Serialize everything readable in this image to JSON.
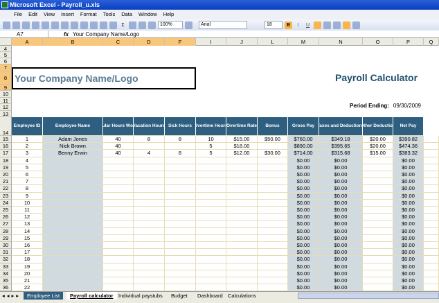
{
  "window": {
    "title": "Microsoft Excel - Payroll_u.xls"
  },
  "menu": [
    "File",
    "Edit",
    "View",
    "Insert",
    "Format",
    "Tools",
    "Data",
    "Window",
    "Help"
  ],
  "toolbar": {
    "zoom": "100%",
    "font": "Arial",
    "font_size": "18",
    "bold": "B",
    "italic": "I",
    "underline": "U",
    "sigma": "Σ"
  },
  "formula_bar": {
    "name_box": "A7",
    "fx": "fx",
    "value": "Your Company Name/Logo"
  },
  "columns": [
    "A",
    "B",
    "C",
    "D",
    "F",
    "I",
    "J",
    "L",
    "M",
    "N",
    "O",
    "P",
    "Q"
  ],
  "sheet": {
    "company": "Your Company Name/Logo",
    "title": "Payroll Calculator",
    "period_label": "Period Ending:",
    "period_value": "09/30/2009",
    "headers": [
      "Employee ID",
      "Employee Name",
      "Regular Hours Worked",
      "Vacation Hours",
      "Sick Hours",
      "Overtime Hours",
      "Overtime Rate",
      "Bonus",
      "Gross Pay",
      "Taxes and Deductions",
      "Other Deduction",
      "Net Pay"
    ],
    "rows": [
      [
        "1",
        "Adam Jones",
        "40",
        "8",
        "8",
        "10",
        "$15.00",
        "$50.00",
        "$760.00",
        "$349.18",
        "$20.00",
        "$390.82"
      ],
      [
        "2",
        "Nick Brown",
        "40",
        "",
        "",
        "5",
        "$18.00",
        "",
        "$890.00",
        "$395.65",
        "$20.00",
        "$474.36"
      ],
      [
        "3",
        "Benny Erwin",
        "40",
        "4",
        "8",
        "5",
        "$12.00",
        "$30.00",
        "$714.00",
        "$315.68",
        "$15.00",
        "$383.32"
      ],
      [
        "4",
        "",
        "",
        "",
        "",
        "",
        "",
        "",
        "$0.00",
        "$0.00",
        "",
        "$0.00"
      ],
      [
        "5",
        "",
        "",
        "",
        "",
        "",
        "",
        "",
        "$0.00",
        "$0.00",
        "",
        "$0.00"
      ],
      [
        "6",
        "",
        "",
        "",
        "",
        "",
        "",
        "",
        "$0.00",
        "$0.00",
        "",
        "$0.00"
      ],
      [
        "7",
        "",
        "",
        "",
        "",
        "",
        "",
        "",
        "$0.00",
        "$0.00",
        "",
        "$0.00"
      ],
      [
        "8",
        "",
        "",
        "",
        "",
        "",
        "",
        "",
        "$0.00",
        "$0.00",
        "",
        "$0.00"
      ],
      [
        "9",
        "",
        "",
        "",
        "",
        "",
        "",
        "",
        "$0.00",
        "$0.00",
        "",
        "$0.00"
      ],
      [
        "10",
        "",
        "",
        "",
        "",
        "",
        "",
        "",
        "$0.00",
        "$0.00",
        "",
        "$0.00"
      ],
      [
        "11",
        "",
        "",
        "",
        "",
        "",
        "",
        "",
        "$0.00",
        "$0.00",
        "",
        "$0.00"
      ],
      [
        "12",
        "",
        "",
        "",
        "",
        "",
        "",
        "",
        "$0.00",
        "$0.00",
        "",
        "$0.00"
      ],
      [
        "13",
        "",
        "",
        "",
        "",
        "",
        "",
        "",
        "$0.00",
        "$0.00",
        "",
        "$0.00"
      ],
      [
        "14",
        "",
        "",
        "",
        "",
        "",
        "",
        "",
        "$0.00",
        "$0.00",
        "",
        "$0.00"
      ],
      [
        "15",
        "",
        "",
        "",
        "",
        "",
        "",
        "",
        "$0.00",
        "$0.00",
        "",
        "$0.00"
      ],
      [
        "16",
        "",
        "",
        "",
        "",
        "",
        "",
        "",
        "$0.00",
        "$0.00",
        "",
        "$0.00"
      ],
      [
        "17",
        "",
        "",
        "",
        "",
        "",
        "",
        "",
        "$0.00",
        "$0.00",
        "",
        "$0.00"
      ],
      [
        "18",
        "",
        "",
        "",
        "",
        "",
        "",
        "",
        "$0.00",
        "$0.00",
        "",
        "$0.00"
      ],
      [
        "19",
        "",
        "",
        "",
        "",
        "",
        "",
        "",
        "$0.00",
        "$0.00",
        "",
        "$0.00"
      ],
      [
        "20",
        "",
        "",
        "",
        "",
        "",
        "",
        "",
        "$0.00",
        "$0.00",
        "",
        "$0.00"
      ],
      [
        "21",
        "",
        "",
        "",
        "",
        "",
        "",
        "",
        "$0.00",
        "$0.00",
        "",
        "$0.00"
      ],
      [
        "22",
        "",
        "",
        "",
        "",
        "",
        "",
        "",
        "$0.00",
        "$0.00",
        "",
        "$0.00"
      ]
    ]
  },
  "tabs": [
    "Employee List",
    "Payroll calculator",
    "Individual paystubs",
    "Budget",
    "Dashboard",
    "Calculations"
  ],
  "active_tab": 1
}
